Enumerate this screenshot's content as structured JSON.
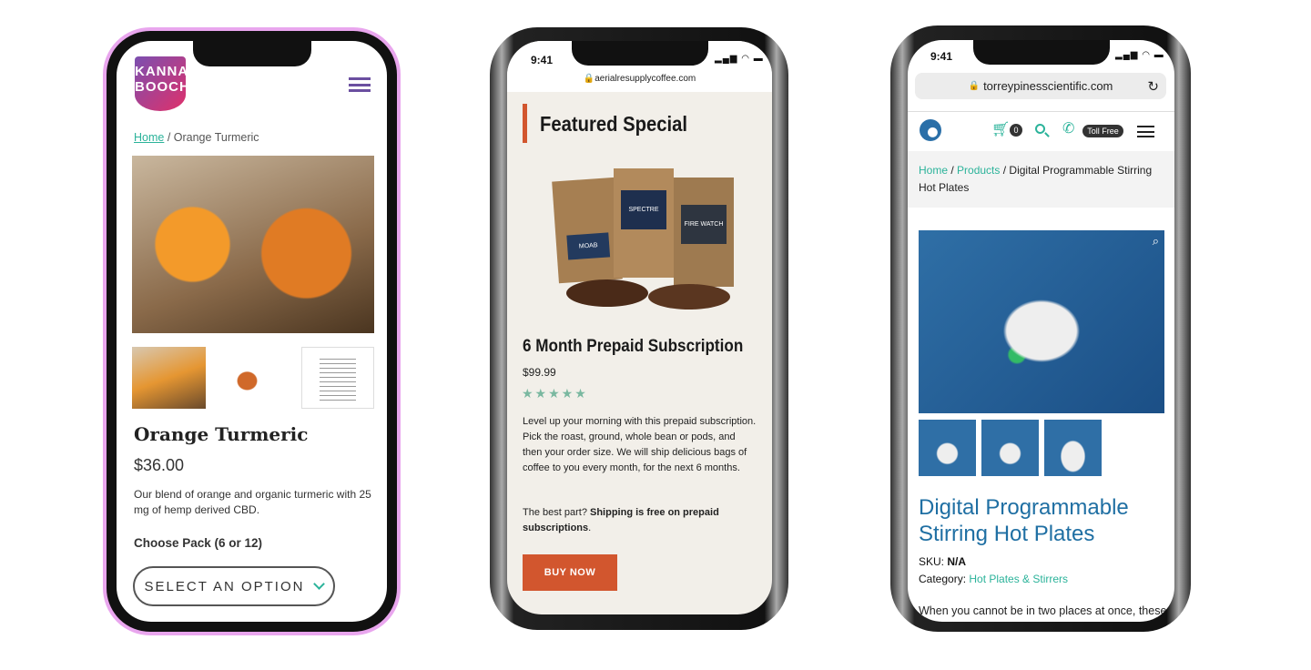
{
  "phone1": {
    "logo": "KANNA BOOCH",
    "breadcrumb_home": "Home",
    "breadcrumb_rest": " / Orange Turmeric",
    "title": "Orange Turmeric",
    "price": "$36.00",
    "description": "Our blend of orange and organic turmeric with 25 mg of hemp derived CBD.",
    "option_label": "Choose Pack (6 or 12)",
    "select_label": "SELECT AN OPTION",
    "colors": {
      "frame": "#e9a6ee",
      "accent": "#6b4fa0",
      "link": "#2bb39a"
    }
  },
  "phone2": {
    "time": "9:41",
    "url": "aerialresupplycoffee.com",
    "heading": "Featured Special",
    "product_title": "6 Month Prepaid Subscription",
    "price": "$99.99",
    "rating": 5,
    "description": "Level up your morning with this prepaid subscription. Pick the roast, ground, whole bean or pods, and then your order size. We will ship delicious bags of coffee to you every month, for the next 6 months.",
    "note_prefix": "The best part? ",
    "note_bold": "Shipping is free on prepaid subscriptions",
    "note_suffix": ".",
    "bag_labels": [
      "MOAB",
      "SPECTRE",
      "FIRE WATCH"
    ],
    "buy_label": "BUY NOW",
    "colors": {
      "accent": "#d2562e",
      "bg": "#f2efe9"
    }
  },
  "phone3": {
    "time": "9:41",
    "url": "torreypinesscientific.com",
    "cart_count": "0",
    "toll_free": "Toll Free",
    "breadcrumb": [
      "Home",
      "Products",
      "Digital Programmable Stirring Hot Plates"
    ],
    "title": "Digital Programmable Stirring Hot Plates",
    "sku_label": "SKU: ",
    "sku": "N/A",
    "category_label": "Category: ",
    "category": "Hot Plates & Stirrers",
    "description": "When you cannot be in two places at once, these",
    "colors": {
      "title": "#1f6fa3",
      "link": "#2bb39a"
    }
  }
}
